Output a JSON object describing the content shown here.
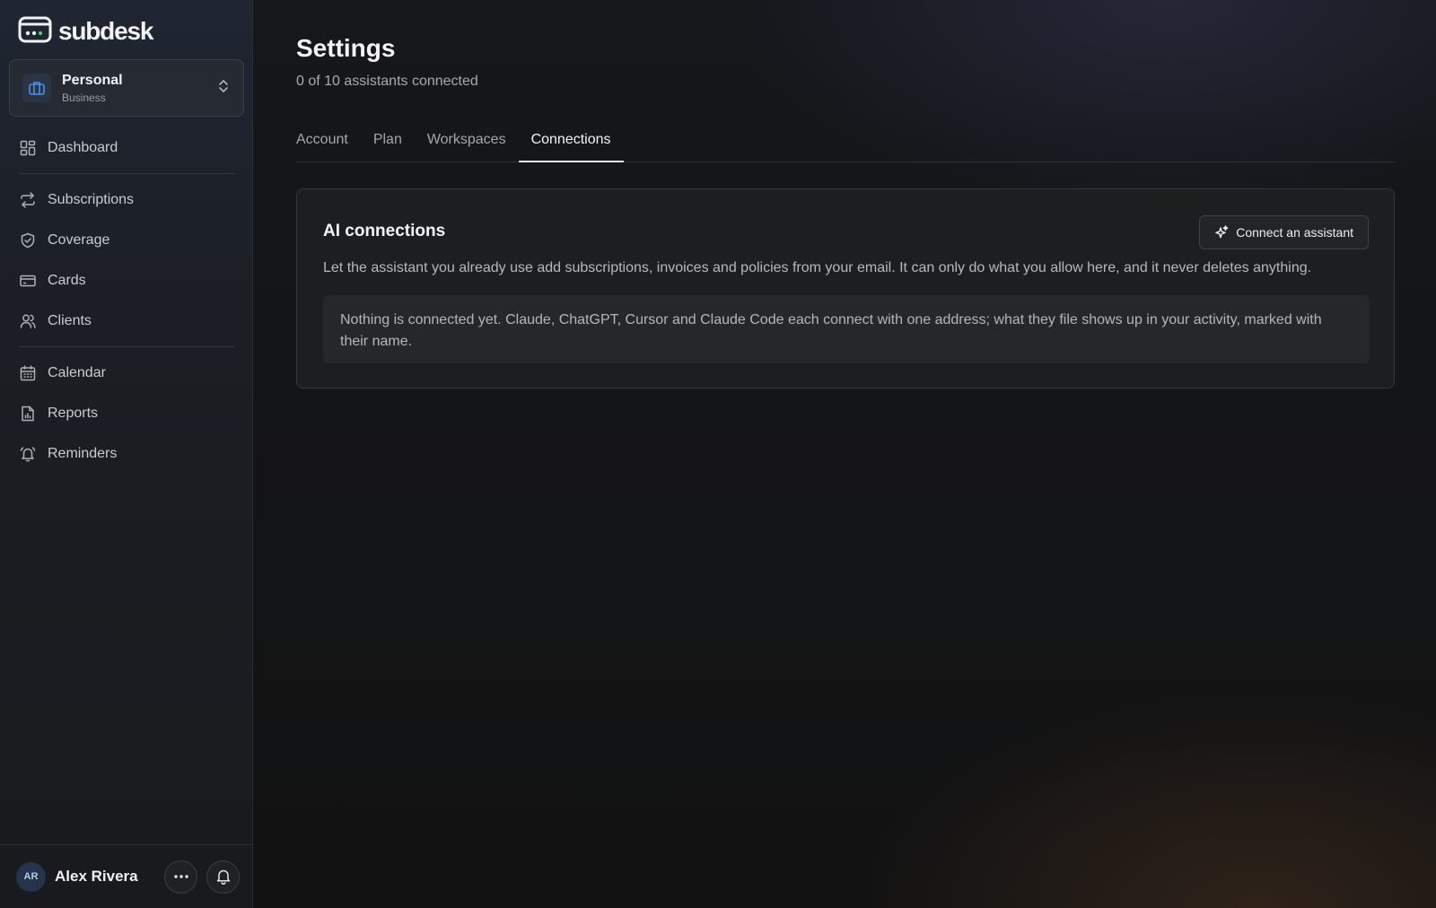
{
  "app": {
    "name": "subdesk"
  },
  "workspace": {
    "name": "Personal",
    "type": "Business"
  },
  "nav": {
    "dashboard": "Dashboard",
    "subscriptions": "Subscriptions",
    "coverage": "Coverage",
    "cards": "Cards",
    "clients": "Clients",
    "calendar": "Calendar",
    "reports": "Reports",
    "reminders": "Reminders"
  },
  "user": {
    "initials": "AR",
    "name": "Alex Rivera"
  },
  "header": {
    "title": "Settings",
    "subtitle": "0 of 10 assistants connected"
  },
  "tabs": {
    "account": "Account",
    "plan": "Plan",
    "workspaces": "Workspaces",
    "connections": "Connections",
    "active": "Connections"
  },
  "ai_connections": {
    "title": "AI connections",
    "connect_button": "Connect an assistant",
    "description": "Let the assistant you already use add subscriptions, invoices and policies from your email. It can only do what you allow here, and it never deletes anything.",
    "empty_message": "Nothing is connected yet. Claude, ChatGPT, Cursor and Claude Code each connect with one address; what they file shows up in your activity, marked with their name."
  },
  "icons": {
    "logo": "subdesk-logo-icon",
    "workspace": "briefcase-icon",
    "switcher": "chevron-up-down-icon",
    "dashboard": "grid-icon",
    "subscriptions": "repeat-icon",
    "coverage": "shield-icon",
    "cards": "credit-card-icon",
    "clients": "users-icon",
    "calendar": "calendar-icon",
    "reports": "report-icon",
    "reminders": "alarm-bell-icon",
    "more": "ellipsis-icon",
    "notifications": "bell-icon",
    "connect": "sparkles-icon"
  },
  "colors": {
    "accent_blue": "#4a8ff0",
    "logo_green": "#3ecf6e",
    "background": "#111111"
  }
}
